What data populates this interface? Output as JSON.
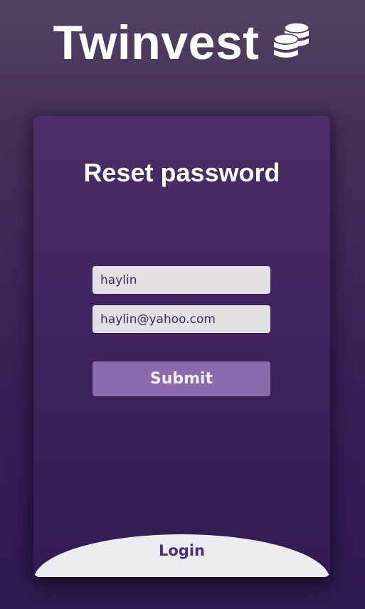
{
  "brand": {
    "name": "Twinvest",
    "icon": "coins-stack-icon",
    "color": "#ffffff"
  },
  "card": {
    "title": "Reset password"
  },
  "form": {
    "username": {
      "value": "haylin"
    },
    "email": {
      "value": "haylin@yahoo.com"
    },
    "submit_label": "Submit"
  },
  "footer": {
    "login_label": "Login"
  },
  "colors": {
    "background_top": "#524262",
    "background_bottom": "#2e1a4f",
    "card": "#3f235e",
    "input_background": "#e3dfe2",
    "submit_background": "#8c6aae",
    "login_area": "#ecebed",
    "login_text": "#4d2f77"
  }
}
